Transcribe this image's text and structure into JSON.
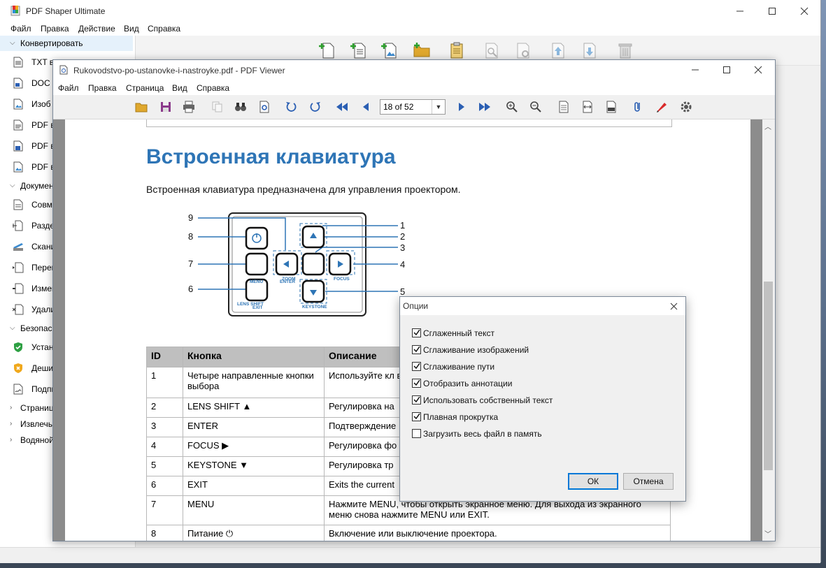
{
  "main": {
    "title": "PDF Shaper Ultimate",
    "menu": [
      "Файл",
      "Правка",
      "Действие",
      "Вид",
      "Справка"
    ],
    "sidebar": {
      "groups": [
        {
          "label": "Конвертировать",
          "expanded": true,
          "items": [
            "TXT в",
            "DOC в",
            "Изоб",
            "PDF в",
            "PDF в",
            "PDF в"
          ]
        },
        {
          "label": "Докумен",
          "expanded": true,
          "items": [
            "Совм",
            "Разде",
            "Скани",
            "Перег",
            "Измен",
            "Удали"
          ]
        },
        {
          "label": "Безопасн",
          "expanded": true,
          "items": [
            "Устан",
            "Деши",
            "Подпи"
          ]
        },
        {
          "label": "Страниц",
          "expanded": false,
          "items": []
        },
        {
          "label": "Извлечь",
          "expanded": false,
          "items": []
        },
        {
          "label": "Водяной",
          "expanded": false,
          "items": []
        }
      ]
    }
  },
  "viewer": {
    "title": "Rukovodstvo-po-ustanovke-i-nastroyke.pdf - PDF Viewer",
    "menu": [
      "Файл",
      "Правка",
      "Страница",
      "Вид",
      "Справка"
    ],
    "page_selector": "18 of 52",
    "document": {
      "heading": "Встроенная клавиатура",
      "intro": "Встроенная клавиатура предназначена для управления проектором.",
      "keypad_labels": {
        "lens_shift": "LENS SHIFT",
        "menu": "MENU",
        "enter": "ENTER",
        "exit": "EXIT",
        "zoom": "ZOOM",
        "focus": "FOCUS",
        "keystone": "KEYSTONE"
      },
      "callouts_left": [
        "9",
        "8",
        "7",
        "6"
      ],
      "callouts_right": [
        "1",
        "2",
        "3",
        "4",
        "5"
      ],
      "table": {
        "headers": [
          "ID",
          "Кнопка",
          "Описание"
        ],
        "rows": [
          [
            "1",
            "Четыре направленные кнопки выбора",
            "Используйте кл внести изменен"
          ],
          [
            "2",
            "LENS SHIFT ▲",
            "Регулировка на"
          ],
          [
            "3",
            "ENTER",
            "Подтверждение"
          ],
          [
            "4",
            "FOCUS ▶",
            "Регулировка фо"
          ],
          [
            "5",
            "KEYSTONE ▼",
            "Регулировка тр"
          ],
          [
            "6",
            "EXIT",
            "Exits the current"
          ],
          [
            "7",
            "MENU",
            "Нажмите MENU, чтобы открыть экранное меню. Для выхода из экранного меню снова нажмите MENU или EXIT."
          ],
          [
            "8",
            "Питание ⏻",
            "Включение или выключение проектора."
          ]
        ]
      }
    }
  },
  "dialog": {
    "title": "Опции",
    "options": [
      {
        "label": "Сглаженный текст",
        "checked": true
      },
      {
        "label": "Сглаживание изображений",
        "checked": true
      },
      {
        "label": "Сглаживание пути",
        "checked": true
      },
      {
        "label": "Отобразить аннотации",
        "checked": true
      },
      {
        "label": "Использовать собственный текст",
        "checked": true
      },
      {
        "label": "Плавная прокрутка",
        "checked": true
      },
      {
        "label": "Загрузить весь файл в память",
        "checked": false
      }
    ],
    "ok_label": "ОК",
    "cancel_label": "Отмена"
  },
  "colors": {
    "heading": "#2e75b6",
    "dialog_focus": "#0078d7",
    "table_header": "#bfbfbf"
  }
}
